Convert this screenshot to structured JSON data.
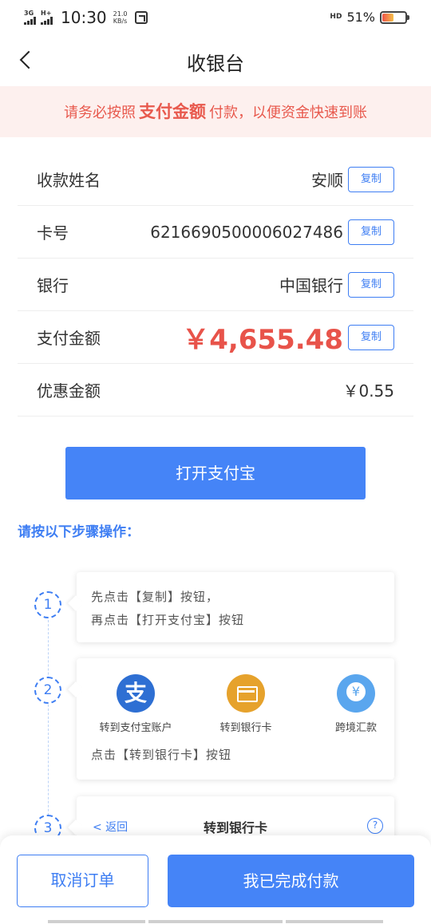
{
  "status_bar": {
    "network_1": "3G",
    "network_2": "H+",
    "time": "10:30",
    "speed_value": "21.0",
    "speed_unit": "KB/s",
    "network_right": "HD",
    "battery_percent": "51%",
    "battery_level": 0.51
  },
  "nav": {
    "back_icon": "chevron-left-icon",
    "title": "收银台"
  },
  "notice": {
    "prefix": "请务必按照",
    "highlight": "支付金额",
    "suffix": "付款，以便资金快速到账"
  },
  "info": {
    "copy_label": "复制",
    "rows": [
      {
        "label": "收款姓名",
        "value": "安顺"
      },
      {
        "label": "卡号",
        "value": "6216690500006027486"
      },
      {
        "label": "银行",
        "value": "中国银行"
      },
      {
        "label": "支付金额",
        "value": "￥4,655.48"
      },
      {
        "label": "优惠金额",
        "value": "￥0.55"
      }
    ]
  },
  "alipay_button": "打开支付宝",
  "steps_title": "请按以下步骤操作：",
  "steps": [
    {
      "number": "1",
      "lines": [
        "先点击【复制】按钮，",
        "再点击【打开支付宝】按钮"
      ]
    },
    {
      "number": "2",
      "options": [
        {
          "icon": "alipay-icon",
          "icon_text": "支",
          "label": "转到支付宝账户"
        },
        {
          "icon": "bank-card-icon",
          "label": "转到银行卡"
        },
        {
          "icon": "remit-icon",
          "label": "跨境汇款"
        }
      ],
      "line": "点击【转到银行卡】按钮"
    },
    {
      "number": "3",
      "back_label": "< 返回",
      "title": "转到银行卡",
      "help_icon": "?"
    }
  ],
  "bottom": {
    "cancel": "取消订单",
    "done": "我已完成付款"
  },
  "colors": {
    "primary": "#4584f7",
    "accent_blue": "#3e7ef3",
    "alert_red": "#e8534a",
    "notice_bg": "#fdf0ee"
  }
}
